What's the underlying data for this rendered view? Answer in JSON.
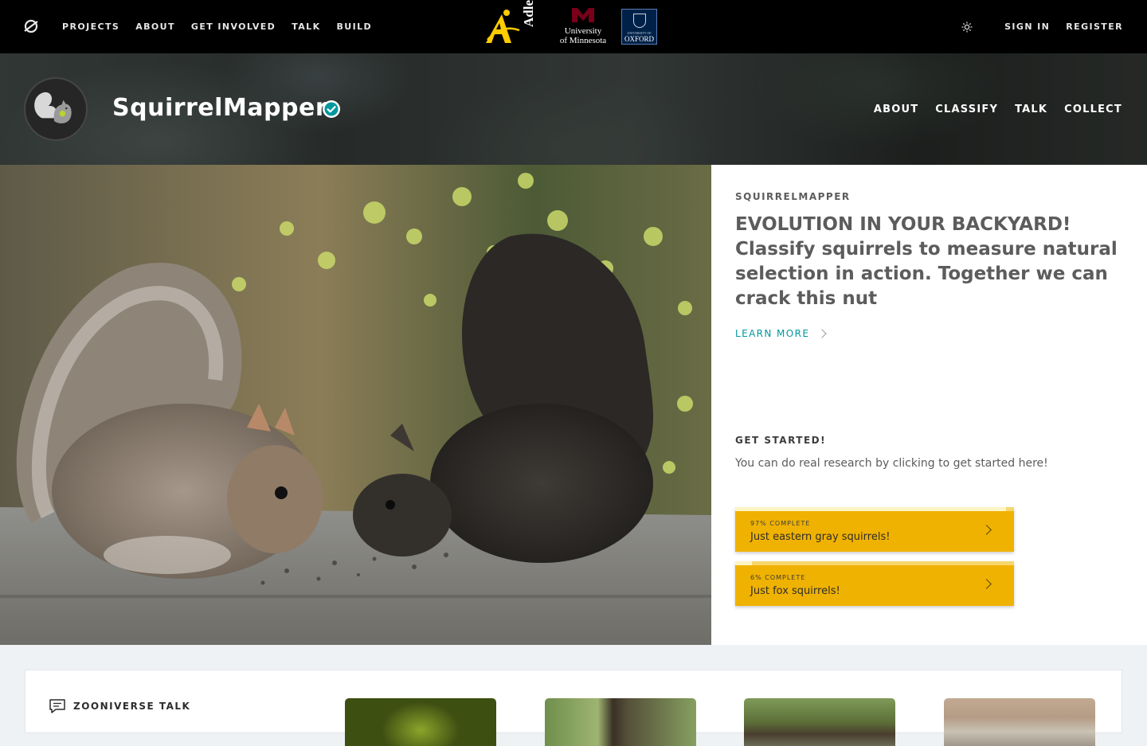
{
  "topbar": {
    "nav": [
      "PROJECTS",
      "ABOUT",
      "GET INVOLVED",
      "TALK",
      "BUILD"
    ],
    "partners": {
      "adler": "Adler",
      "umn_line1": "University",
      "umn_line2": "of Minnesota",
      "oxford_small": "UNIVERSITY OF",
      "oxford": "OXFORD"
    },
    "sign_in": "SIGN IN",
    "register": "REGISTER"
  },
  "project": {
    "title": "SquirrelMapper",
    "nav": [
      "ABOUT",
      "CLASSIFY",
      "TALK",
      "COLLECT"
    ]
  },
  "hero": {
    "label": "SQUIRRELMAPPER",
    "description": "EVOLUTION IN YOUR BACKYARD! Classify squirrels to measure natural selection in action. Together we can crack this nut",
    "learn_more": "LEARN MORE",
    "get_started_label": "GET STARTED!",
    "get_started_text": "You can do real research by clicking to get started here!",
    "workflows": [
      {
        "percent_label": "97% COMPLETE",
        "completion": 0.97,
        "name": "Just eastern gray squirrels!"
      },
      {
        "percent_label": "6% COMPLETE",
        "completion": 0.06,
        "name": "Just fox squirrels!"
      }
    ]
  },
  "talk": {
    "label": "ZOONIVERSE TALK"
  },
  "icons": {
    "site_logo": "zooniverse-logo-icon",
    "theme": "sun-icon",
    "verified": "verified-check-icon",
    "talk": "speech-bubble-icon"
  },
  "colors": {
    "accent_yellow": "#f0b200",
    "link_teal": "#00979d",
    "verified_teal": "#00979d"
  }
}
